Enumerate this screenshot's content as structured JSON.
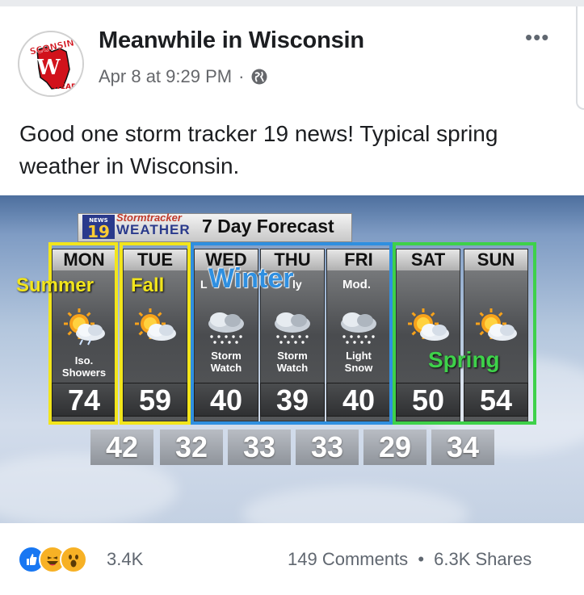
{
  "post": {
    "page_name": "Meanwhile in Wisconsin",
    "timestamp": "Apr 8 at 9:29 PM",
    "separator": "·",
    "more_label": "•••",
    "caption": "Good one storm tracker 19 news! Typical spring weather in Wisconsin.",
    "avatar": {
      "top_text": "SCONSIN",
      "bottom_text": "WEAR"
    }
  },
  "weather_image": {
    "brand_small": "NEWS",
    "brand_number": "19",
    "brand_top": "Stormtracker",
    "brand_bottom": "WEATHER",
    "title": "7 Day Forecast",
    "days": [
      {
        "day": "MON",
        "condition": "Iso. Showers",
        "icon": "sun-rain-icon",
        "high": "74",
        "low": "42"
      },
      {
        "day": "TUE",
        "condition": "",
        "icon": "sun-cloud-icon",
        "high": "59",
        "low": "32"
      },
      {
        "day": "WED",
        "condition": "Storm Watch",
        "icon": "snow-cloud-icon",
        "high": "40",
        "low": "33"
      },
      {
        "day": "THU",
        "condition": "Storm Watch",
        "icon": "snow-cloud-icon",
        "high": "39",
        "low": "33"
      },
      {
        "day": "FRI",
        "condition": "Light Snow",
        "icon": "snow-cloud-icon",
        "high": "40",
        "low": "29"
      },
      {
        "day": "SAT",
        "condition": "",
        "icon": "sun-cloud-icon",
        "high": "50",
        "low": "34"
      },
      {
        "day": "SUN",
        "condition": "",
        "icon": "sun-cloud-icon",
        "high": "54",
        "low": ""
      }
    ],
    "overlays": {
      "summer": "Summer",
      "fall": "Fall",
      "winter_prefix": "L",
      "winter": "Winter",
      "winter_suffix": "ly",
      "mod": "Mod.",
      "spring": "Spring"
    },
    "colors": {
      "summer_fall": "#f2e51c",
      "winter": "#2f8fe0",
      "spring": "#3ed14a"
    }
  },
  "footer": {
    "reactions": [
      "like-icon",
      "haha-icon",
      "wow-icon"
    ],
    "reaction_count": "3.4K",
    "comments": "149 Comments",
    "dot": "•",
    "shares": "6.3K Shares"
  }
}
